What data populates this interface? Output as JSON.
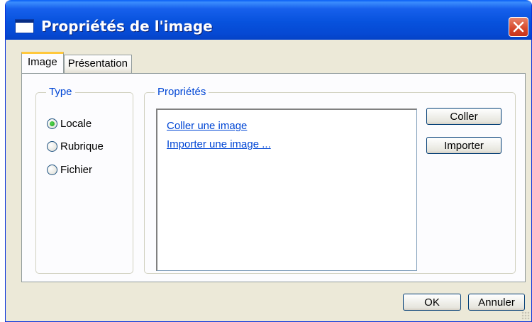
{
  "window": {
    "title": "Propriétés de l'image",
    "close_icon": "close-icon"
  },
  "tabs": [
    {
      "label": "Image",
      "active": true
    },
    {
      "label": "Présentation",
      "active": false
    }
  ],
  "type_group": {
    "legend": "Type",
    "options": [
      {
        "label": "Locale",
        "checked": true
      },
      {
        "label": "Rubrique",
        "checked": false
      },
      {
        "label": "Fichier",
        "checked": false
      }
    ]
  },
  "properties_group": {
    "legend": "Propriétés",
    "links": [
      "Coller une image",
      "Importer  une image ..."
    ],
    "buttons": {
      "paste": "Coller",
      "import": "Importer"
    }
  },
  "footer": {
    "ok": "OK",
    "cancel": "Annuler"
  },
  "colors": {
    "titlebar": "#0752dd",
    "dialog_bg": "#ece9d8",
    "link": "#0046d5",
    "close_button": "#d6472a",
    "active_tab_highlight": "#ffc83c"
  }
}
